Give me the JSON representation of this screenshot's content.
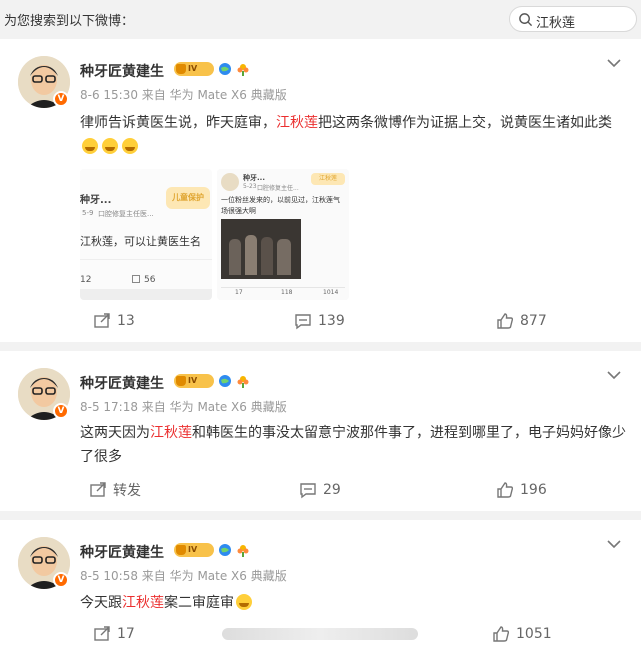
{
  "header": {
    "label": "为您搜索到以下微博：",
    "search_value": "江秋莲",
    "search_icon": "search-icon"
  },
  "posts": [
    {
      "author": "种牙匠黄建生",
      "level": "IV",
      "meta": "8-6 15:30 来自 华为 Mate X6 典藏版",
      "text_before": "律师告诉黄医生说，昨天庭审，",
      "highlight": "江秋莲",
      "text_after": "把这两条微博作为证据上交，说黄医生诸如此类",
      "images": [
        {
          "author": "种牙...",
          "date": "5-9",
          "sub": "口腔修复主任医...",
          "body": "江秋莲，可以让黄医生名",
          "count_a": "12",
          "count_b": "56",
          "stamp": "儿童保护"
        },
        {
          "author": "种牙...",
          "date": "5-23",
          "sub": "口腔修复主任...",
          "body": "一位粉丝发来的，以前见过，江秋莲气场很强大啊",
          "count_a": "17",
          "count_b": "118",
          "count_c": "1014",
          "stamp": "江秋莲"
        }
      ],
      "reposts": "13",
      "comments": "139",
      "likes": "877"
    },
    {
      "author": "种牙匠黄建生",
      "level": "IV",
      "meta": "8-5 17:18 来自 华为 Mate X6 典藏版",
      "text_before": "这两天因为",
      "highlight": "江秋莲",
      "text_after": "和韩医生的事没太留意宁波那件事了，进程到哪里了，电子妈妈好像少了很多",
      "reposts": "转发",
      "comments": "29",
      "likes": "196"
    },
    {
      "author": "种牙匠黄建生",
      "level": "IV",
      "meta": "8-5 10:58 来自 华为 Mate X6 典藏版",
      "text_before": "今天跟",
      "highlight": "江秋莲",
      "text_after": "案二审庭审",
      "reposts": "17",
      "likes": "1051"
    }
  ],
  "colors": {
    "highlight": "#eb2f2f",
    "crown": "#f8c24a",
    "verified": "#ff6a00"
  }
}
